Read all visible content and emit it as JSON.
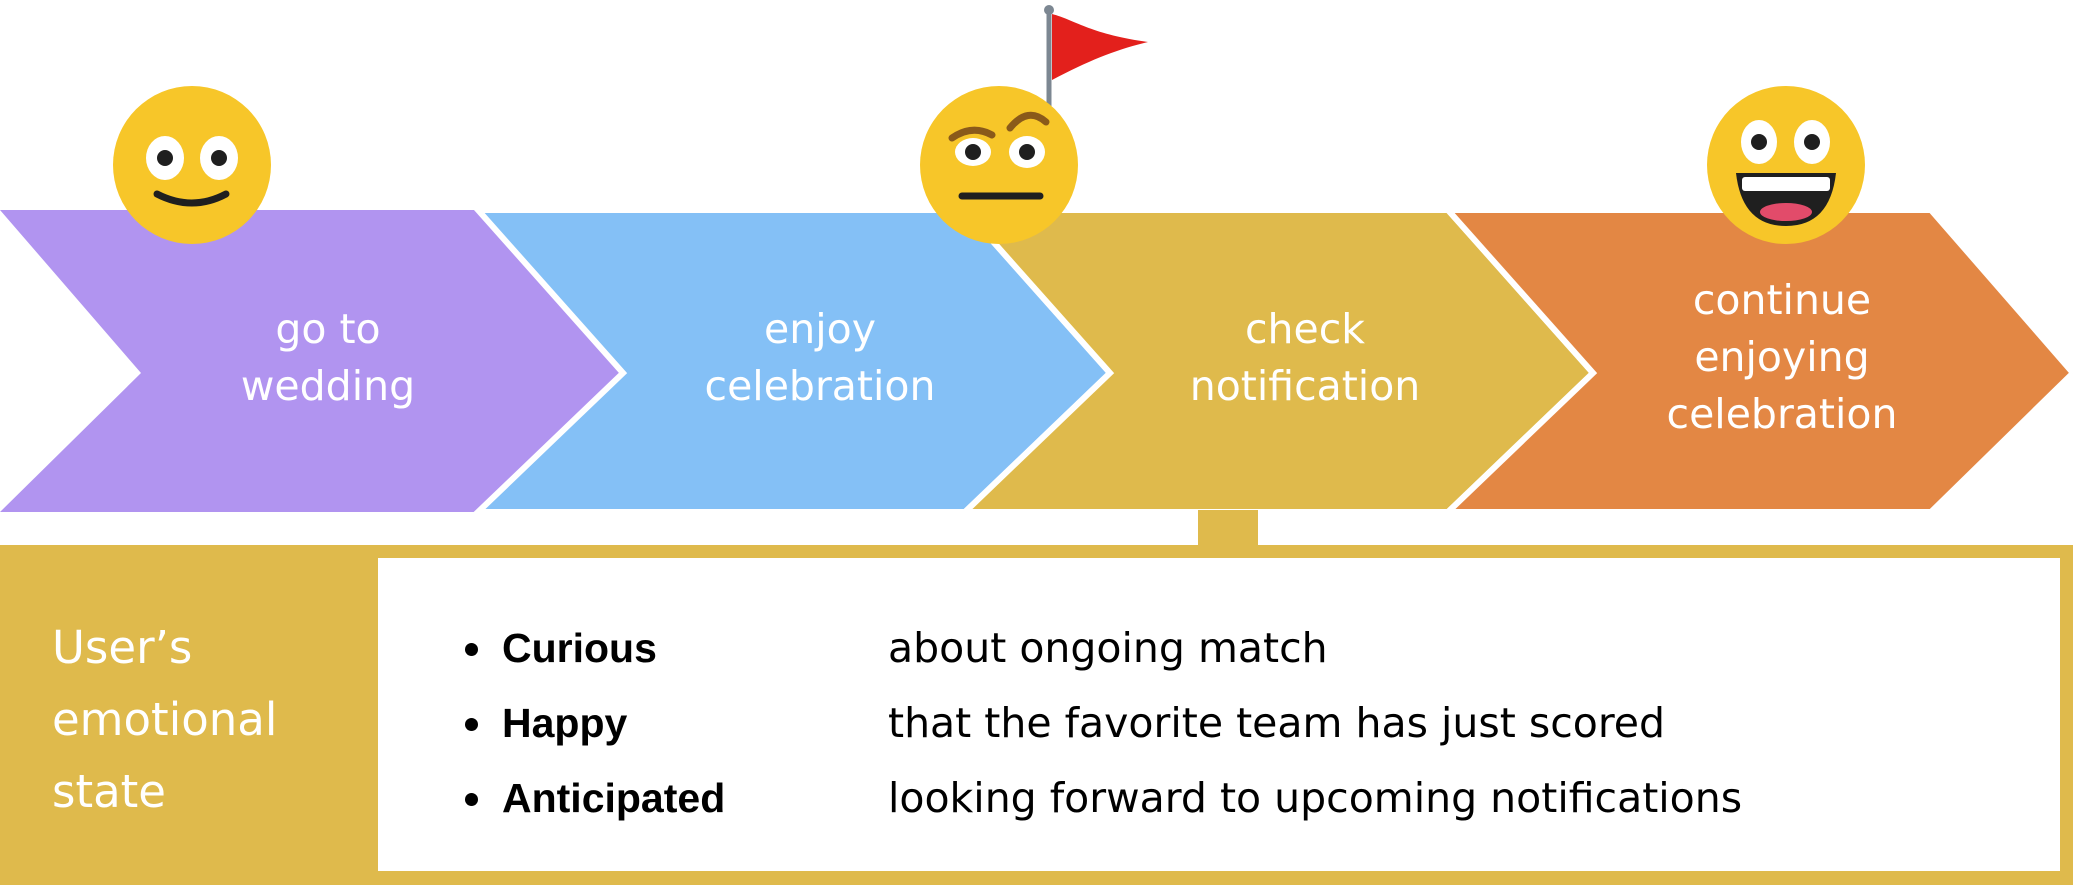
{
  "colors": {
    "step_1": "#B194F0",
    "step_2": "#84C0F6",
    "step_3": "#DFBA4C",
    "step_4": "#E38744",
    "panel": "#DFBA4C",
    "emoji_face": "#F7C629",
    "flag": "#E3201C"
  },
  "steps": [
    {
      "lines": [
        "go to",
        "wedding"
      ],
      "emotion_icon": "slightly-smiling-face-icon"
    },
    {
      "lines": [
        "enjoy",
        "celebration"
      ],
      "emotion_icon": null
    },
    {
      "lines": [
        "check",
        "notification"
      ],
      "emotion_icon": "face-with-raised-eyebrow-icon",
      "marker_icon": "red-flag-icon"
    },
    {
      "lines": [
        "continue",
        "enjoying",
        "celebration"
      ],
      "emotion_icon": "grinning-face-icon"
    }
  ],
  "emotional_state": {
    "title_lines": [
      "User’s",
      "emotional",
      "state"
    ],
    "items": [
      {
        "emotion": "Curious",
        "description": "about ongoing match"
      },
      {
        "emotion": "Happy",
        "description": "that the favorite team has just scored"
      },
      {
        "emotion": "Anticipated",
        "description": "looking forward to upcoming notifications"
      }
    ]
  }
}
